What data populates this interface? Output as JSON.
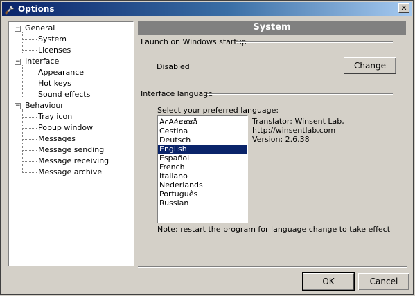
{
  "window": {
    "title": "Options",
    "close_glyph": "✕"
  },
  "tree": {
    "groups": [
      {
        "label": "General",
        "expander": "−",
        "children": [
          "System",
          "Licenses"
        ]
      },
      {
        "label": "Interface",
        "expander": "−",
        "children": [
          "Appearance",
          "Hot keys",
          "Sound effects"
        ]
      },
      {
        "label": "Behaviour",
        "expander": "−",
        "children": [
          "Tray icon",
          "Popup window",
          "Messages",
          "Message sending",
          "Message receiving",
          "Message archive"
        ]
      }
    ]
  },
  "panel": {
    "title": "System",
    "startup": {
      "group_label": "Launch on Windows startup",
      "status": "Disabled",
      "change_button": "Change"
    },
    "language": {
      "group_label": "Interface language",
      "prompt": "Select your preferred language:",
      "options": [
        "ÁcÃé¤¤¤å",
        "Cestina",
        "Deutsch",
        "English",
        "Español",
        "French",
        "Italiano",
        "Nederlands",
        "Português",
        "Russian"
      ],
      "selected": "English",
      "translator": "Translator: Winsent Lab,",
      "url": "http://winsentlab.com",
      "version": "Version: 2.6.38",
      "note": "Note: restart the program for language change to take effect"
    }
  },
  "footer": {
    "ok": "OK",
    "cancel": "Cancel"
  }
}
